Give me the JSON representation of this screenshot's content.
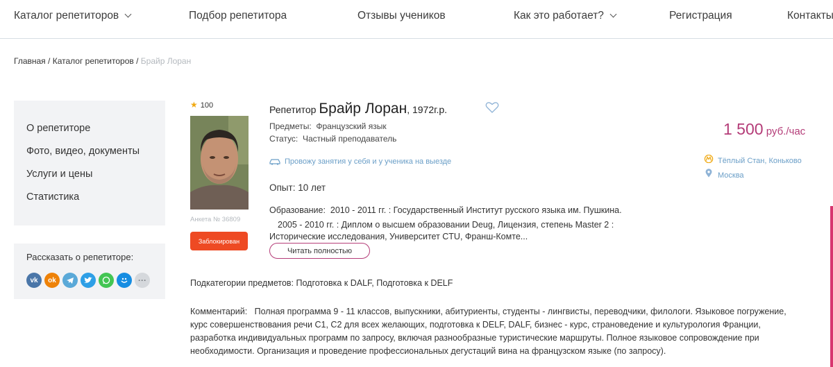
{
  "nav": {
    "catalog": "Каталог репетиторов",
    "selection": "Подбор репетитора",
    "reviews": "Отзывы учеников",
    "how": "Как это работает?",
    "register": "Регистрация",
    "contacts": "Контакты"
  },
  "breadcrumb": {
    "home": "Главная",
    "sep1": " / ",
    "catalog": "Каталог репетиторов",
    "sep2": " / ",
    "current": "Брайр Лоран"
  },
  "sidebar": {
    "items": [
      "О репетиторе",
      "Фото, видео, документы",
      "Услуги и цены",
      "Статистика"
    ],
    "share_title": "Рассказать о репетиторе:",
    "social": [
      "vk-icon",
      "odnoklassniki-icon",
      "telegram-icon",
      "twitter-icon",
      "whatsapp-icon",
      "moimir-icon",
      "more-icon"
    ]
  },
  "profile": {
    "rating": "100",
    "anketa": "Анкета № 36809",
    "blocked": "Заблокирован",
    "role": "Репетитор ",
    "name": "Брайр Лоран",
    "year": ", 1972г.р.",
    "subjects_label": "Предметы:",
    "subjects_value": "Французский язык",
    "status_label": "Статус:",
    "status_value": "Частный преподаватель",
    "travel": "Провожу занятия у себя и у ученика на выезде",
    "experience": "Опыт: 10 лет",
    "education_label": "Образование:",
    "education_lines": [
      "2010 - 2011 гг. : Государственный Институт русского языка им. Пушкина.",
      "2005 - 2010 гг. : Диплом о высшем образовании Deug, Лицензия, степень Master 2 :",
      "Исторические исследования, Университет CTU, Франш-Комте..."
    ],
    "read_more": "Читать полностью",
    "price_amount": "1 500",
    "price_unit": " руб./час",
    "metro": "Тёплый Стан, Коньково",
    "city": "Москва"
  },
  "subcategories": {
    "label": "Подкатегории предметов:",
    "value": "Подготовка к DALF, Подготовка к DELF"
  },
  "comment": {
    "label": "Комментарий:",
    "lines": [
      "Полная программа 9 - 11 классов, выпускники, абитуриенты, студенты - лингвисты, переводчики, филологи. Языковое погружение,",
      "курс совершенствования речи С1, С2 для всех желающих, подготовка к DELF, DALF, бизнес - курс, страноведение и культурология Франции,",
      "разработка индивидуальных программ по запросу, включая разнообразные туристические маршруты. Полное языковое сопровождение при",
      "необходимости. Организация и проведение профессиональных дегустаций вина на французском языке (по запросу)."
    ]
  },
  "colors": {
    "accent": "#b43c78",
    "link": "#6a9ec7",
    "blocked": "#ee4a23",
    "star": "#f0a912",
    "panel": "#f2f3f5"
  }
}
